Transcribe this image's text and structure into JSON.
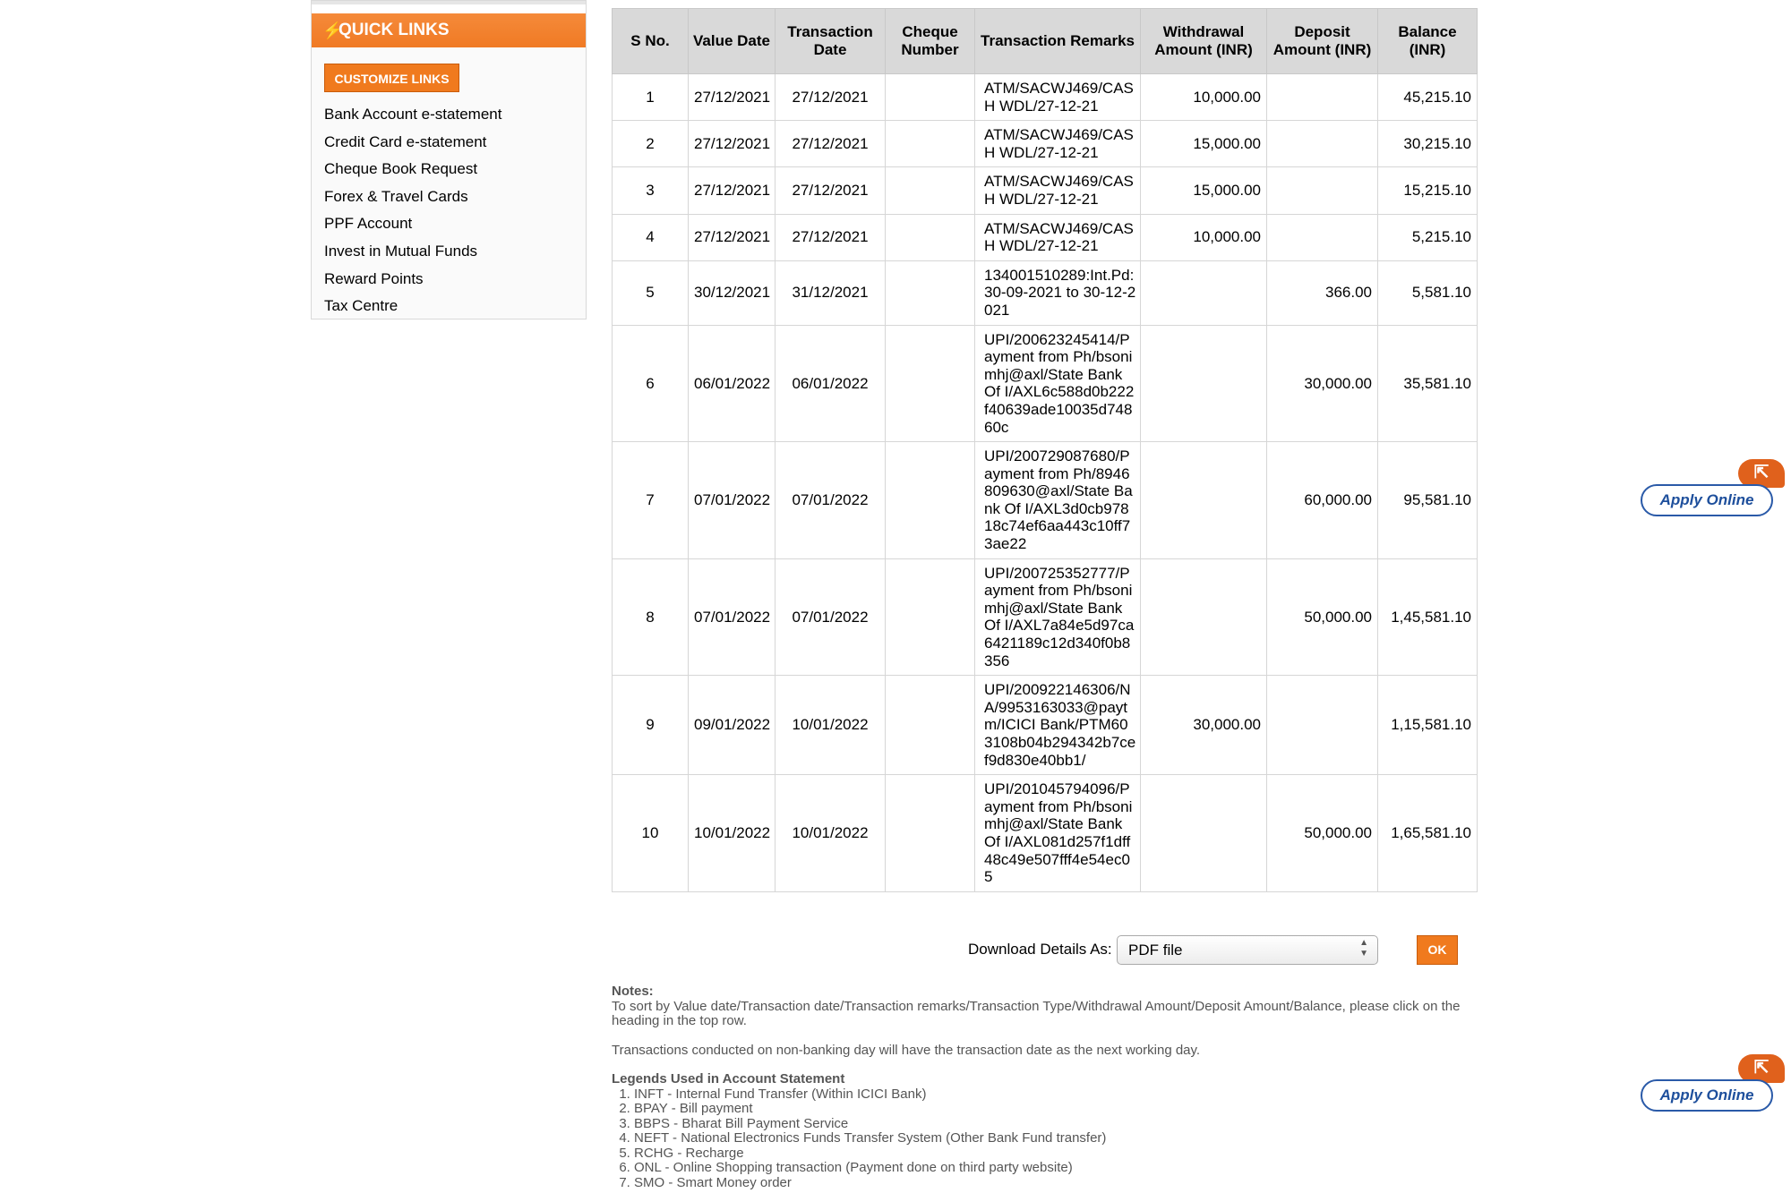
{
  "quick_links": {
    "title": "QUICK LINKS",
    "bolt_icon": "⚡",
    "customize_label": "CUSTOMIZE LINKS",
    "items": [
      {
        "label": "Bank Account e-statement"
      },
      {
        "label": "Credit Card e-statement"
      },
      {
        "label": "Cheque Book Request"
      },
      {
        "label": "Forex & Travel Cards"
      },
      {
        "label": "PPF Account"
      },
      {
        "label": "Invest in Mutual Funds"
      },
      {
        "label": "Reward Points"
      },
      {
        "label": "Tax Centre"
      }
    ]
  },
  "table": {
    "headers": [
      "S No.",
      "Value Date",
      "Transaction Date",
      "Cheque Number",
      "Transaction Remarks",
      "Withdrawal Amount (INR)",
      "Deposit Amount (INR)",
      "Balance (INR)"
    ],
    "rows": [
      {
        "sno": "1",
        "value_date": "27/12/2021",
        "txn_date": "27/12/2021",
        "cheque": "",
        "remarks": "ATM/SACWJ469/CASH WDL/27-12-21",
        "withdrawal": "10,000.00",
        "deposit": "",
        "balance": "45,215.10"
      },
      {
        "sno": "2",
        "value_date": "27/12/2021",
        "txn_date": "27/12/2021",
        "cheque": "",
        "remarks": "ATM/SACWJ469/CASH WDL/27-12-21",
        "withdrawal": "15,000.00",
        "deposit": "",
        "balance": "30,215.10"
      },
      {
        "sno": "3",
        "value_date": "27/12/2021",
        "txn_date": "27/12/2021",
        "cheque": "",
        "remarks": "ATM/SACWJ469/CASH WDL/27-12-21",
        "withdrawal": "15,000.00",
        "deposit": "",
        "balance": "15,215.10"
      },
      {
        "sno": "4",
        "value_date": "27/12/2021",
        "txn_date": "27/12/2021",
        "cheque": "",
        "remarks": "ATM/SACWJ469/CASH WDL/27-12-21",
        "withdrawal": "10,000.00",
        "deposit": "",
        "balance": "5,215.10"
      },
      {
        "sno": "5",
        "value_date": "30/12/2021",
        "txn_date": "31/12/2021",
        "cheque": "",
        "remarks": "134001510289:Int.Pd:30-09-2021 to 30-12-2021",
        "withdrawal": "",
        "deposit": "366.00",
        "balance": "5,581.10"
      },
      {
        "sno": "6",
        "value_date": "06/01/2022",
        "txn_date": "06/01/2022",
        "cheque": "",
        "remarks": "UPI/200623245414/Payment from Ph/bsonimhj@axl/State Bank Of I/AXL6c588d0b222f40639ade10035d74860c",
        "withdrawal": "",
        "deposit": "30,000.00",
        "balance": "35,581.10"
      },
      {
        "sno": "7",
        "value_date": "07/01/2022",
        "txn_date": "07/01/2022",
        "cheque": "",
        "remarks": "UPI/200729087680/Payment from Ph/8946809630@axl/State Bank Of I/AXL3d0cb97818c74ef6aa443c10ff73ae22",
        "withdrawal": "",
        "deposit": "60,000.00",
        "balance": "95,581.10"
      },
      {
        "sno": "8",
        "value_date": "07/01/2022",
        "txn_date": "07/01/2022",
        "cheque": "",
        "remarks": "UPI/200725352777/Payment from Ph/bsonimhj@axl/State Bank Of I/AXL7a84e5d97ca6421189c12d340f0b8356",
        "withdrawal": "",
        "deposit": "50,000.00",
        "balance": "1,45,581.10"
      },
      {
        "sno": "9",
        "value_date": "09/01/2022",
        "txn_date": "10/01/2022",
        "cheque": "",
        "remarks": "UPI/200922146306/NA/9953163033@paytm/ICICI Bank/PTM603108b04b294342b7cef9d830e40bb1/",
        "withdrawal": "30,000.00",
        "deposit": "",
        "balance": "1,15,581.10"
      },
      {
        "sno": "10",
        "value_date": "10/01/2022",
        "txn_date": "10/01/2022",
        "cheque": "",
        "remarks": "UPI/201045794096/Payment from Ph/bsonimhj@axl/State Bank Of I/AXL081d257f1dff48c49e507fff4e54ec05",
        "withdrawal": "",
        "deposit": "50,000.00",
        "balance": "1,65,581.10"
      }
    ]
  },
  "download": {
    "label": "Download Details As:",
    "selected": "PDF file",
    "ok_label": "OK"
  },
  "notes": {
    "heading": "Notes:",
    "sort_note": "To sort by Value date/Transaction date/Transaction remarks/Transaction Type/Withdrawal Amount/Deposit Amount/Balance, please click on the heading in the top row.",
    "nonbanking_note": "Transactions conducted on non-banking day will have the transaction date as the next working day.",
    "legends_heading": "Legends Used in Account Statement",
    "legends": [
      "INFT - Internal Fund Transfer (Within ICICI Bank)",
      "BPAY - Bill payment",
      "BBPS - Bharat Bill Payment Service",
      "NEFT - National Electronics Funds Transfer System (Other Bank Fund transfer)",
      "RCHG - Recharge",
      "ONL - Online Shopping transaction (Payment done on third party website)",
      "SMO - Smart Money order"
    ]
  },
  "apply_online": {
    "label": "Apply Online",
    "icon": "⇱"
  },
  "colors": {
    "accent_orange": "#f07a1e",
    "apply_blue": "#1e4f9c",
    "header_gray": "#d9d9d9"
  }
}
